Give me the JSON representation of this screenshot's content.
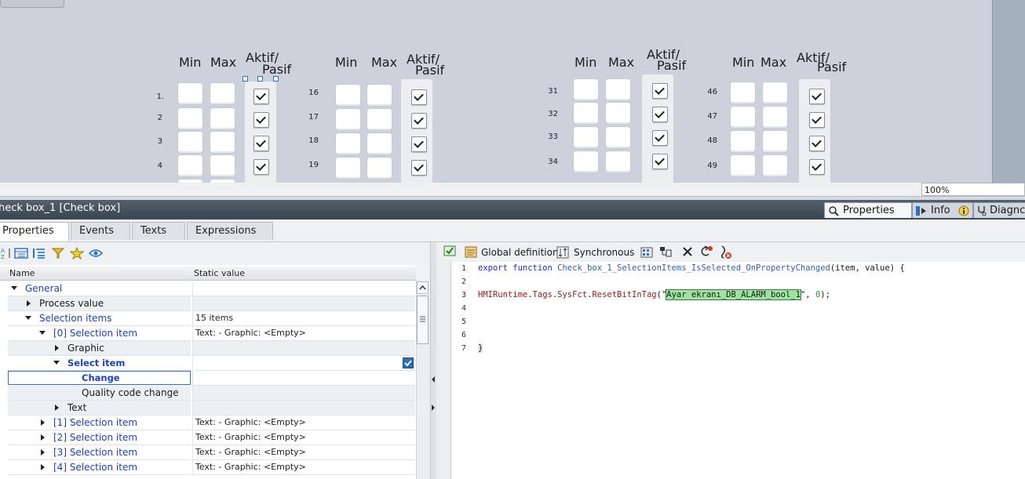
{
  "canvas": {
    "column_headers": {
      "min": "Min",
      "max": "Max",
      "aktif_line1": "Aktif/",
      "aktif_line2": "Pasif"
    },
    "groups": [
      {
        "rows": [
          "1.",
          "2",
          "3",
          "4"
        ]
      },
      {
        "rows": [
          "16",
          "17",
          "18",
          "19"
        ]
      },
      {
        "rows": [
          "31",
          "32",
          "33",
          "34"
        ]
      },
      {
        "rows": [
          "46",
          "47",
          "48",
          "49"
        ]
      }
    ],
    "zoom": "100%"
  },
  "inspector": {
    "title": "heck box_1 [Check box]",
    "tabs": {
      "properties": "Properties",
      "info": "Info",
      "diagnostics": "Diagnc"
    },
    "subtabs": [
      "Properties",
      "Events",
      "Texts",
      "Expressions"
    ],
    "grid": {
      "col_name": "Name",
      "col_value": "Static value",
      "rows": [
        {
          "label": "General",
          "value": ""
        },
        {
          "label": "Process value",
          "value": ""
        },
        {
          "label": "Selection items",
          "value": "15 items"
        },
        {
          "label": "[0] Selection item",
          "value": "Text:  - Graphic: <Empty>"
        },
        {
          "label": "Graphic",
          "value": ""
        },
        {
          "label": "Select item",
          "value": ""
        },
        {
          "label": "Change",
          "value": ""
        },
        {
          "label": "Quality code change",
          "value": ""
        },
        {
          "label": "Text",
          "value": ""
        },
        {
          "label": "[1] Selection item",
          "value": "Text:  - Graphic: <Empty>"
        },
        {
          "label": "[2] Selection item",
          "value": "Text:  - Graphic: <Empty>"
        },
        {
          "label": "[3] Selection item",
          "value": "Text:  - Graphic: <Empty>"
        },
        {
          "label": "[4] Selection item",
          "value": "Text:  - Graphic: <Empty>"
        }
      ]
    }
  },
  "editor": {
    "toolbar": {
      "global_definition": "Global definition",
      "synchronous": "Synchronous"
    },
    "line_numbers": [
      "1",
      "2",
      "3",
      "4",
      "5",
      "6",
      "7"
    ],
    "line1": {
      "kw": "export function",
      "name": "Check_box_1_SelectionItems_IsSelected_OnPropertyChanged",
      "args": "(item, value) {"
    },
    "line3": {
      "obj": "HMIRuntime",
      "dot1": ".",
      "tags": "Tags",
      "dot2": ".",
      "sysfct": "SysFct",
      "dot3": ".",
      "fn": "ResetBitInTag",
      "open": "(\"",
      "tag": "Ayar ekranı_DB_ALARM_bool_1",
      "close": "\", ",
      "zero": "0",
      "end": ");"
    },
    "line7": "}"
  }
}
